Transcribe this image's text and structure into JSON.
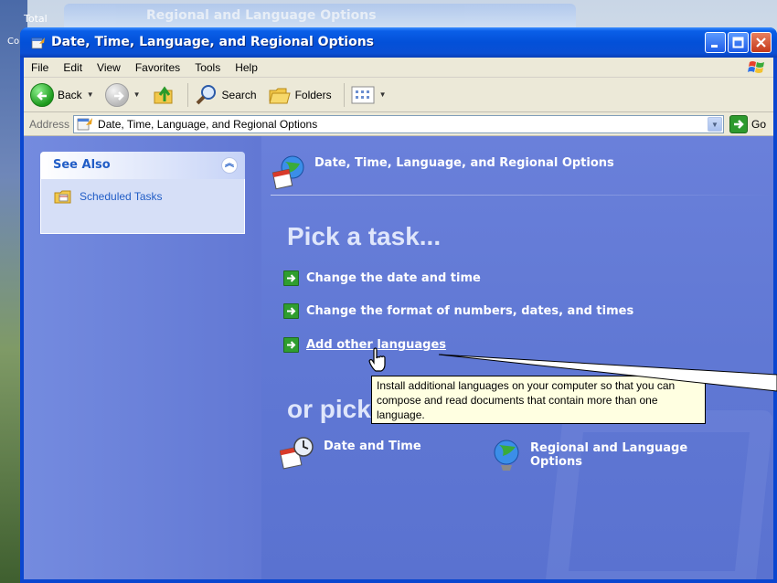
{
  "background": {
    "window_title": "Regional and Language Options",
    "left_label_1": "Total",
    "left_label_2": "Co"
  },
  "window": {
    "title": "Date, Time, Language, and Regional Options"
  },
  "menu": [
    "File",
    "Edit",
    "View",
    "Favorites",
    "Tools",
    "Help"
  ],
  "toolbar": {
    "back_label": "Back",
    "search_label": "Search",
    "folders_label": "Folders"
  },
  "address": {
    "label": "Address",
    "value": "Date, Time, Language, and Regional Options",
    "go_label": "Go"
  },
  "sidebar": {
    "see_also_title": "See Also",
    "items": [
      {
        "label": "Scheduled Tasks"
      }
    ]
  },
  "main": {
    "header_title": "Date, Time, Language, and Regional Options",
    "pick_task": "Pick a task...",
    "tasks": [
      {
        "label": "Change the date and time"
      },
      {
        "label": "Change the format of numbers, dates, and times"
      },
      {
        "label": "Add other languages"
      }
    ],
    "or_pick": "or pick a Control Panel icon",
    "icons": [
      {
        "label": "Date and Time"
      },
      {
        "label_line1": "Regional and Language",
        "label_line2": "Options"
      }
    ]
  },
  "tooltip": {
    "line1": "Install additional languages on your computer so that you can",
    "line2": "compose and read documents that contain more than one",
    "line3": "language."
  },
  "colors": {
    "title_bar": "#0350d8",
    "content_bg": "#6078d4",
    "link_blue": "#215dc6",
    "task_arrow_green": "#2f9e2f",
    "tooltip_bg": "#ffffe1"
  }
}
